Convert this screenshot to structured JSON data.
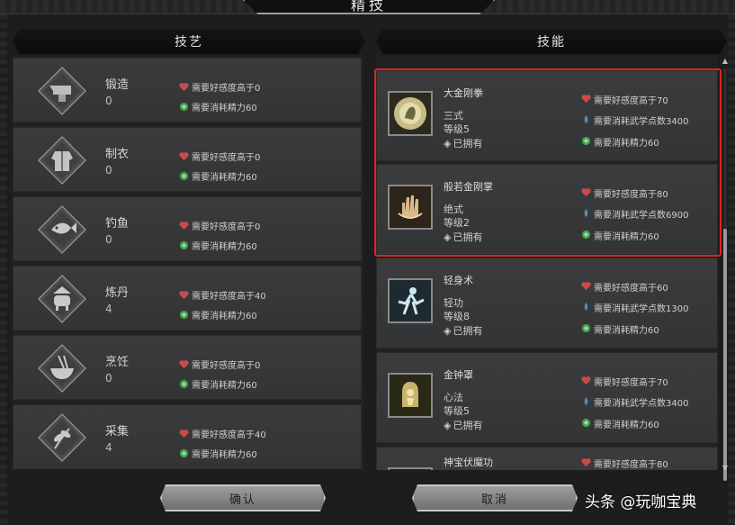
{
  "window": {
    "title": "精技"
  },
  "crafts_header": "技艺",
  "skills_header": "技能",
  "crafts": [
    {
      "name": "锻造",
      "level": "0",
      "req_favor": "需要好感度高于0",
      "req_energy": "需要消耗精力60"
    },
    {
      "name": "制衣",
      "level": "0",
      "req_favor": "需要好感度高于0",
      "req_energy": "需要消耗精力60"
    },
    {
      "name": "钓鱼",
      "level": "0",
      "req_favor": "需要好感度高于0",
      "req_energy": "需要消耗精力60"
    },
    {
      "name": "炼丹",
      "level": "4",
      "req_favor": "需要好感度高于40",
      "req_energy": "需要消耗精力60"
    },
    {
      "name": "烹饪",
      "level": "0",
      "req_favor": "需要好感度高于0",
      "req_energy": "需要消耗精力60"
    },
    {
      "name": "采集",
      "level": "4",
      "req_favor": "需要好感度高于40",
      "req_energy": "需要消耗精力60"
    }
  ],
  "skills": [
    {
      "name": "大金刚拳",
      "type": "三式",
      "grade": "等级5",
      "owned": "已拥有",
      "req_favor": "需要好感度高于70",
      "req_points": "需要消耗武学点数3400",
      "req_energy": "需要消耗精力60"
    },
    {
      "name": "般若金刚掌",
      "type": "绝式",
      "grade": "等级2",
      "owned": "已拥有",
      "req_favor": "需要好感度高于80",
      "req_points": "需要消耗武学点数6900",
      "req_energy": "需要消耗精力60"
    },
    {
      "name": "轻身术",
      "type": "轻功",
      "grade": "等级8",
      "owned": "已拥有",
      "req_favor": "需要好感度高于60",
      "req_points": "需要消耗武学点数1300",
      "req_energy": "需要消耗精力60"
    },
    {
      "name": "金钟罩",
      "type": "心法",
      "grade": "等级5",
      "owned": "已拥有",
      "req_favor": "需要好感度高于70",
      "req_points": "需要消耗武学点数3400",
      "req_energy": "需要消耗精力60"
    },
    {
      "name": "神宝伏魔功",
      "type": "",
      "grade": "",
      "owned": "",
      "req_favor": "需要好感度高于80",
      "req_points": "",
      "req_energy": ""
    }
  ],
  "buttons": {
    "confirm": "确认",
    "cancel": "取消"
  },
  "watermark": "头条 @玩咖宝典",
  "colors": {
    "highlight": "#e02323",
    "heart": "#c94a4a",
    "energy": "#3fa34d",
    "points": "#4a90c2"
  },
  "icons": {
    "crafts": [
      "anvil-icon",
      "robe-icon",
      "fish-icon",
      "cauldron-icon",
      "bowl-icon",
      "herb-icon"
    ],
    "skills": [
      "fist-icon",
      "palm-icon",
      "leap-icon",
      "bell-icon",
      "demon-icon"
    ]
  }
}
